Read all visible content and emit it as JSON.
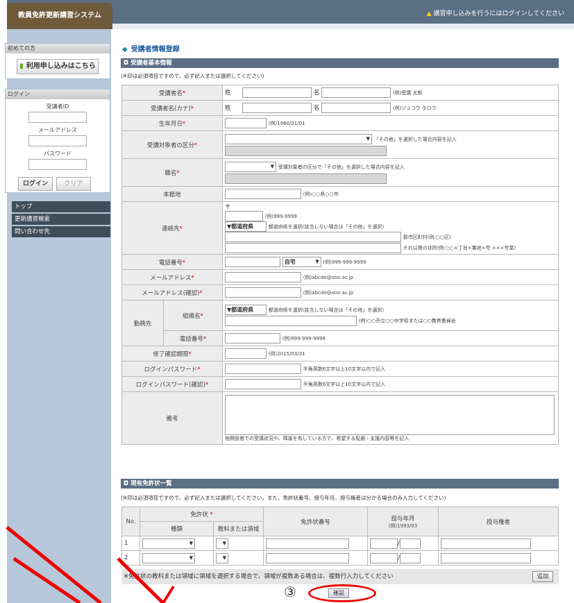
{
  "header": {
    "logo": "教員免許更新講習システム",
    "notice": "講習申し込みを行うにはログインしてください"
  },
  "sidebar": {
    "first_time": {
      "title": "初めての方",
      "button": "利用申し込みはこちら"
    },
    "login": {
      "title": "ログイン",
      "id_label": "受講者ID",
      "mail_label": "メールアドレス",
      "password_label": "パスワード",
      "login_button": "ログイン",
      "clear_button": "クリア"
    },
    "nav": [
      "トップ",
      "更新講習検索",
      "問い合わせ先"
    ]
  },
  "main": {
    "page_title": "受講者情報登録",
    "section1": "受講者基本情報",
    "note1": "(※印は必須項目ですので、必ず記入または選択してください)",
    "fields": {
      "name": {
        "label": "受講者名",
        "sei": "姓",
        "mei": "名",
        "example": "(例)受講 太郎"
      },
      "kana": {
        "label": "受講者名(カナ)",
        "sei": "姓",
        "mei": "名",
        "example": "(例)ジュコウ タロウ"
      },
      "birth": {
        "label": "生年月日",
        "example": "(例)1960/01/01"
      },
      "category": {
        "label": "受講対象者の区分",
        "hint": "「その他」を選択した場合内容を記入"
      },
      "job": {
        "label": "職名",
        "hint": "受講対象者の区分で「その他」を選択した場合内容を記入"
      },
      "honseki": {
        "label": "本籍地",
        "example": "(例)○○県○○市"
      },
      "contact": {
        "label": "連絡先",
        "zip_mark": "〒",
        "zip_example": "(例)999-9999",
        "pref_select": "▼都道府県",
        "pref_hint": "都道府県を選択(該当しない場合は「その他」を選択)",
        "city_hint": "郡市区町村(例:○○区)",
        "addr_hint": "それ以降の住所(例:○○×丁目×番地×号 ×××号室)"
      },
      "phone": {
        "label": "電話番号",
        "type_select": "自宅",
        "example": "(例)999-999-9999"
      },
      "email": {
        "label": "メールアドレス",
        "example": "(例)abcde@ooo.ac.jp"
      },
      "email_confirm": {
        "label": "メールアドレス(確認)",
        "example": "(例)abcde@ooo.ac.jp"
      },
      "workplace": {
        "label": "勤務先",
        "org_label": "組織名",
        "pref_select": "▼都道府県",
        "pref_hint": "都道府県を選択(該当しない場合は「その他」を選択)",
        "org_example": "(例)○○市立○○中学校または○○教育委員会",
        "phone_label": "電話番号",
        "phone_example": "(例)999-999-9999"
      },
      "deadline": {
        "label": "修了確認期限",
        "example": "(例)2015/03/31"
      },
      "password": {
        "label": "ログインパスワード",
        "hint": "半角英数6文字以上10文字以内で記入"
      },
      "password_confirm": {
        "label": "ログインパスワード(確認)",
        "hint": "半角英数6文字以上10文字以内で記入"
      },
      "remarks": {
        "label": "備考",
        "hint": "他開設者での受講状況や、障害を有している方で、希望する配慮・支援内容等を記入"
      }
    },
    "required_mark": "*",
    "section2": "現有免許状一覧",
    "note2": "(※印は必須項目ですので、必ず記入または選択してください。また、免許状番号、授与年月、授与権者は分かる場合のみ入力してください)",
    "license_table": {
      "headers": {
        "no": "No.",
        "license": "免許状",
        "type": "種類",
        "subject": "教科または領域",
        "number": "免許状番号",
        "date": "授与年月",
        "date_example": "(例)1993/03",
        "grantor": "授与権者"
      },
      "rows": [
        "1",
        "2"
      ],
      "slash": "/"
    },
    "add_note": "※免許状の教科または領域に領域を選択する場合で、領域が複数ある場合は、複数行入力してください",
    "add_button": "追加",
    "confirm_button": "確認",
    "step_number": "③"
  }
}
